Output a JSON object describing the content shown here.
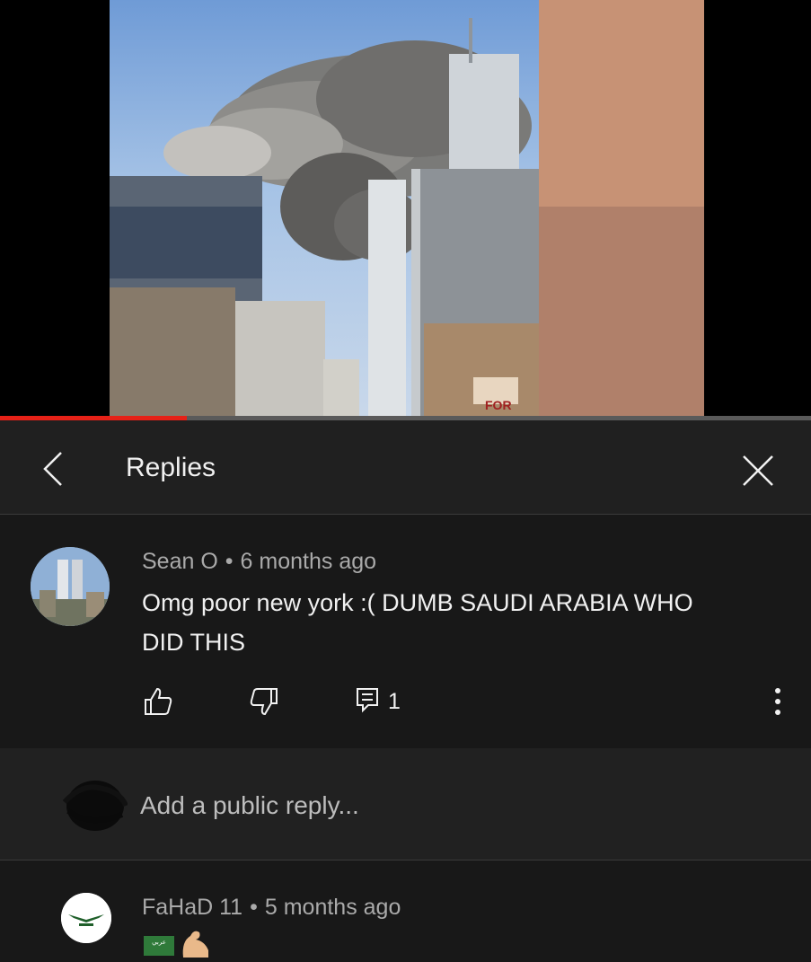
{
  "video": {
    "progress_percent": 23,
    "sign_text": "FOR"
  },
  "replies_panel": {
    "title": "Replies"
  },
  "comment": {
    "author": "Sean O",
    "separator": "•",
    "time": "6 months ago",
    "text_line1": "Omg poor new york :( DUMB SAUDI ARABIA WHO",
    "text_line2": "DID THIS",
    "reply_count": "1"
  },
  "add_reply": {
    "placeholder": "Add a public reply..."
  },
  "reply": {
    "author": "FaHaD 11",
    "separator": "•",
    "time": "5 months ago",
    "flag_text": "عربي"
  },
  "colors": {
    "background": "#181818",
    "header_background": "#202020",
    "progress_red": "#e62117",
    "meta_grey": "#aaaaaa"
  },
  "icons": [
    "back-chevron-icon",
    "close-icon",
    "like-icon",
    "dislike-icon",
    "reply-icon",
    "more-vertical-icon",
    "flag-icon",
    "flexed-arm-icon"
  ]
}
